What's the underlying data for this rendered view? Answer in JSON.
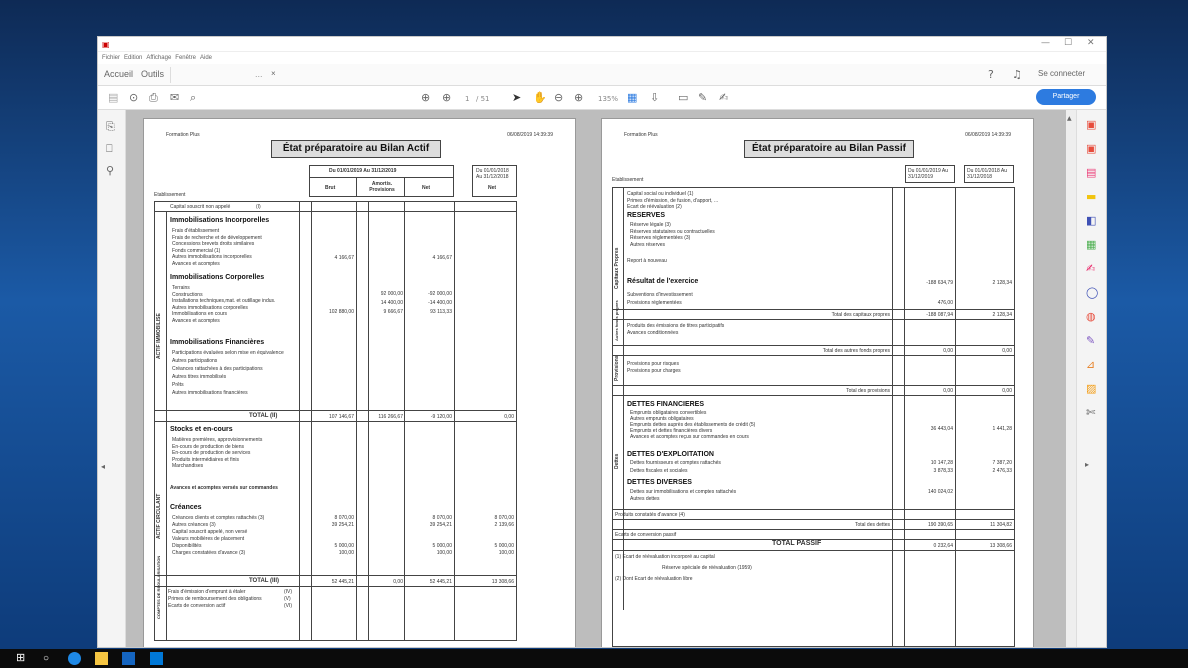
{
  "window": {
    "menu": [
      "Fichier",
      "Edition",
      "Affichage",
      "Fenêtre",
      "Aide"
    ]
  },
  "tabs": {
    "home": "Accueil",
    "tools": "Outils",
    "doc_tab": "..."
  },
  "header_right": {
    "help_icon": "help-icon",
    "bell_icon": "bell-icon",
    "connect": "Se connecter"
  },
  "toolbar": {
    "page_current": "1",
    "page_total": "/ 51",
    "zoom": "135%",
    "share": "Partager"
  },
  "page_left": {
    "company": "Formation Plus",
    "datetime": "06/08/2019 14:39:39",
    "title": "État préparatoire au Bilan Actif",
    "period": "Du 01/01/2019 Au 31/12/2019",
    "prev_period": "Du 01/01/2018 Au 31/12/2018",
    "etab": "Etablissement",
    "cols": [
      "Brut",
      "Amortis. Provisions",
      "Net",
      "Net"
    ],
    "capital": "Capital souscrit non appelé",
    "capital_ref": "(I)",
    "sec1": "Immobilisations Incorporelles",
    "sec1_rows": [
      "Frais d'établissement",
      "Frais de recherche et de développement",
      "Concessions brevets droits similaires",
      "Fonds commercial (1)",
      "Autres immobilisations incorporelles",
      "Avances et acomptes"
    ],
    "sec1_val": "4 166,67",
    "sec2": "Immobilisations Corporelles",
    "sec2_rows": [
      "Terrains",
      "Constructions",
      "Installations techniques,mat. et outillage indus.",
      "Autres immobilisations corporelles",
      "Immobilisations en cours",
      "Avances et acomptes"
    ],
    "sec2_vals": [
      "102 880,00",
      "92 000,00",
      "14 400,00",
      "9 666,67",
      "-92 000,00",
      "-14 400,00",
      "93 113,33"
    ],
    "sec3": "Immobilisations Financières",
    "sec3_rows": [
      "Participations évaluées selon mise en équivalence",
      "Autres participations",
      "Créances rattachées à des participations",
      "Autres titres immobilisés",
      "Prêts",
      "Autres immobilisations financières"
    ],
    "side1": "ACTIF IMMOBILISE",
    "total1": "TOTAL (II)",
    "total1_vals": [
      "107 146,67",
      "116 266,67",
      "-9 120,00",
      "0,00"
    ],
    "sec4": "Stocks et en-cours",
    "sec4_rows": [
      "Matières premières, approvisionnements",
      "En-cours de production de biens",
      "En-cours de production de services",
      "Produits intermédiaires et finis",
      "Marchandises"
    ],
    "avances": "Avances et acomptes versés sur commandes",
    "sec5": "Créances",
    "sec5_rows": [
      "Créances clients et comptes rattachés (3)",
      "Autres créances (3)",
      "Capital souscrit appelé, non versé",
      "Valeurs mobilières de placement",
      "Disponibilités",
      "Charges constatées d'avance (3)"
    ],
    "sec5_vals": [
      "8 070,00",
      "39 254,21",
      "5 000,00",
      "100,00"
    ],
    "sec5_nets": [
      "8 070,00",
      "39 254,21",
      "5 000,00",
      "100,00"
    ],
    "sec5_prev": [
      "8 070,00",
      "2 139,66",
      "5 000,00",
      "100,00"
    ],
    "side2": "ACTIF CIRCULANT",
    "total2": "TOTAL (III)",
    "total2_vals": [
      "52 445,21",
      "0,00",
      "52 445,21",
      "13 308,66"
    ],
    "side3": "COMPTES DE REGULARISATION",
    "foot_rows": [
      "Frais d'émission d'emprunt à étaler",
      "Primes de remboursement des obligations",
      "Ecarts de conversion actif"
    ],
    "foot_refs": [
      "(IV)",
      "(V)",
      "(VI)"
    ]
  },
  "page_right": {
    "company": "Formation Plus",
    "datetime": "06/08/2019 14:39:39",
    "title": "État préparatoire au Bilan Passif",
    "period": "Du 01/01/2019 Au 31/12/2019",
    "prev_period": "Du 01/01/2018 Au 31/12/2018",
    "etab": "Etablissement",
    "cp_rows": [
      "Capital social ou individuel (1)",
      "Primes d'émission, de fusion, d'apport, ...",
      "Ecart de réévaluation (2)"
    ],
    "reserves": "RESERVES",
    "reserves_rows": [
      "Réserve légale (3)",
      "Réserves statutaires ou contractuelles",
      "Réserves réglementées (3)",
      "Autres réserves"
    ],
    "report": "Report à nouveau",
    "resultat": "Résultat de l'exercice",
    "resultat_vals": [
      "-188 634,79",
      "2 128,34"
    ],
    "subv": "Subventions d'investissement",
    "prov_regl": "Provisions réglementées",
    "prov_regl_val": "476,00",
    "tot_cp": "Total des capitaux propres",
    "tot_cp_vals": [
      "-188 087,94",
      "2 128,34"
    ],
    "side_cp": "Capitaux Propres",
    "af_rows": [
      "Produits des émissions de titres participatifs",
      "Avances conditionnées"
    ],
    "side_af": "Autres fonds propres",
    "tot_af": "Total des autres fonds propres",
    "zero": "0,00",
    "prov_rows": [
      "Provisions pour risques",
      "Provisions pour charges"
    ],
    "side_prov": "Provisions",
    "tot_prov": "Total des provisions",
    "df": "DETTES FINANCIERES",
    "df_rows": [
      "Emprunts obligataires convertibles",
      "Autres emprunts obligataires",
      "Emprunts dettes auprès des établissements de crédit (5)",
      "Emprunts et dettes financières divers",
      "Avances et acomptes reçus sur commandes en cours"
    ],
    "df_vals": [
      "36 443,04",
      "1 441,28"
    ],
    "de": "DETTES D'EXPLOITATION",
    "de_rows": [
      "Dettes fournisseurs et comptes rattachés",
      "Dettes fiscales et sociales"
    ],
    "de_vals": [
      "10 147,28",
      "3 878,33",
      "7 387,20",
      "2 476,33"
    ],
    "dd": "DETTES DIVERSES",
    "dd_rows": [
      "Dettes sur immobilisations et comptes rattachés",
      "Autres dettes"
    ],
    "dd_val": "140 024,02",
    "side_dettes": "Dettes",
    "pca": "Produits constatés d'avance (4)",
    "tot_dettes": "Total des dettes",
    "tot_dettes_vals": [
      "190 390,65",
      "11 304,82"
    ],
    "ecart": "Ecarts de conversion passif",
    "total_passif": "TOTAL PASSIF",
    "total_passif_vals": [
      "0 232,64",
      "13 308,66"
    ],
    "foot1": "(1) Ecart de réévaluation incorporé au capital",
    "foot2": "Réserve spéciale de réévaluation (1959)",
    "foot3": "(2) Dont  Ecart de réévaluation libre"
  }
}
